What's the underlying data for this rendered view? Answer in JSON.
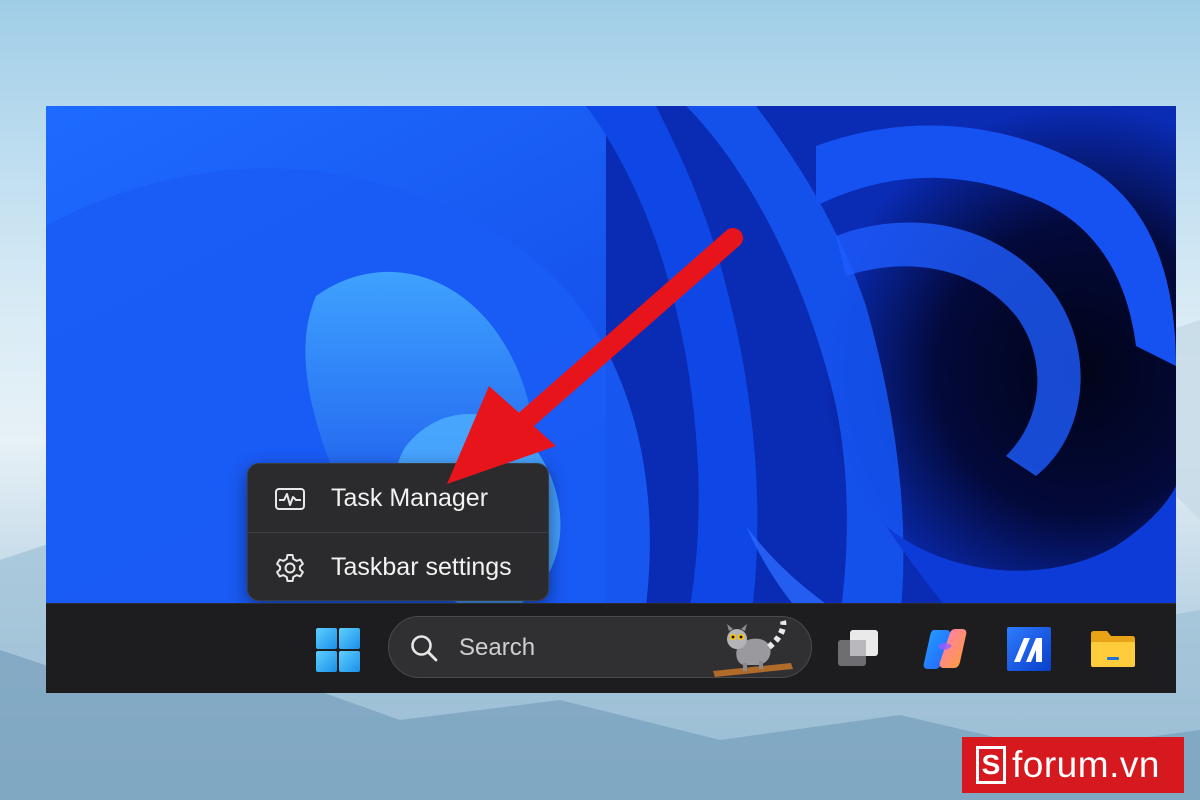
{
  "context_menu": {
    "items": [
      {
        "label": "Task Manager",
        "icon": "task-manager-icon"
      },
      {
        "label": "Taskbar settings",
        "icon": "gear-icon"
      }
    ]
  },
  "taskbar": {
    "search": {
      "placeholder": "Search",
      "icon": "search-icon"
    },
    "apps": [
      "task-view-icon",
      "copilot-icon",
      "metatrader-icon",
      "file-explorer-icon"
    ]
  },
  "watermark": {
    "brand": "sforum.vn",
    "text": "forum.vn"
  },
  "colors": {
    "annotation_arrow": "#e8141c",
    "brand": "#d6191f",
    "taskbar": "#1d1d1f",
    "menu": "#2b2b2d"
  }
}
